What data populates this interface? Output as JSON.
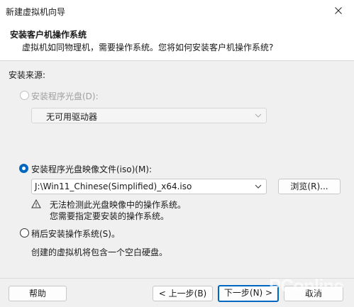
{
  "window": {
    "title": "新建虚拟机向导"
  },
  "header": {
    "title": "安装客户机操作系统",
    "subtitle": "虚拟机如同物理机，需要操作系统。您将如何安装客户机操作系统?"
  },
  "install_source_label": "安装来源:",
  "options": {
    "disc": {
      "label": "安装程序光盘(D):",
      "selected": false,
      "enabled": false
    },
    "drive_select": {
      "value": "无可用驱动器"
    },
    "iso": {
      "label": "安装程序光盘映像文件(iso)(M):",
      "selected": true,
      "enabled": true
    },
    "iso_path": {
      "value": "J:\\Win11_Chinese(Simplified)_x64.iso"
    },
    "browse_label": "浏览(R)...",
    "warning_line1": "无法检测此光盘映像中的操作系统。",
    "warning_line2": "您需要指定要安装的操作系统。",
    "later": {
      "label": "稍后安装操作系统(S)。",
      "selected": false,
      "enabled": true
    },
    "later_desc": "创建的虚拟机将包含一个空白硬盘。"
  },
  "footer": {
    "help_label": "帮助",
    "back_label": "< 上一步(B)",
    "next_label": "下一步(N) >",
    "cancel_label": "取消"
  },
  "watermark": "PConline",
  "colors": {
    "accent": "#0067c0",
    "header_bg": "#ffffff",
    "body_bg": "#f0f0f0"
  }
}
